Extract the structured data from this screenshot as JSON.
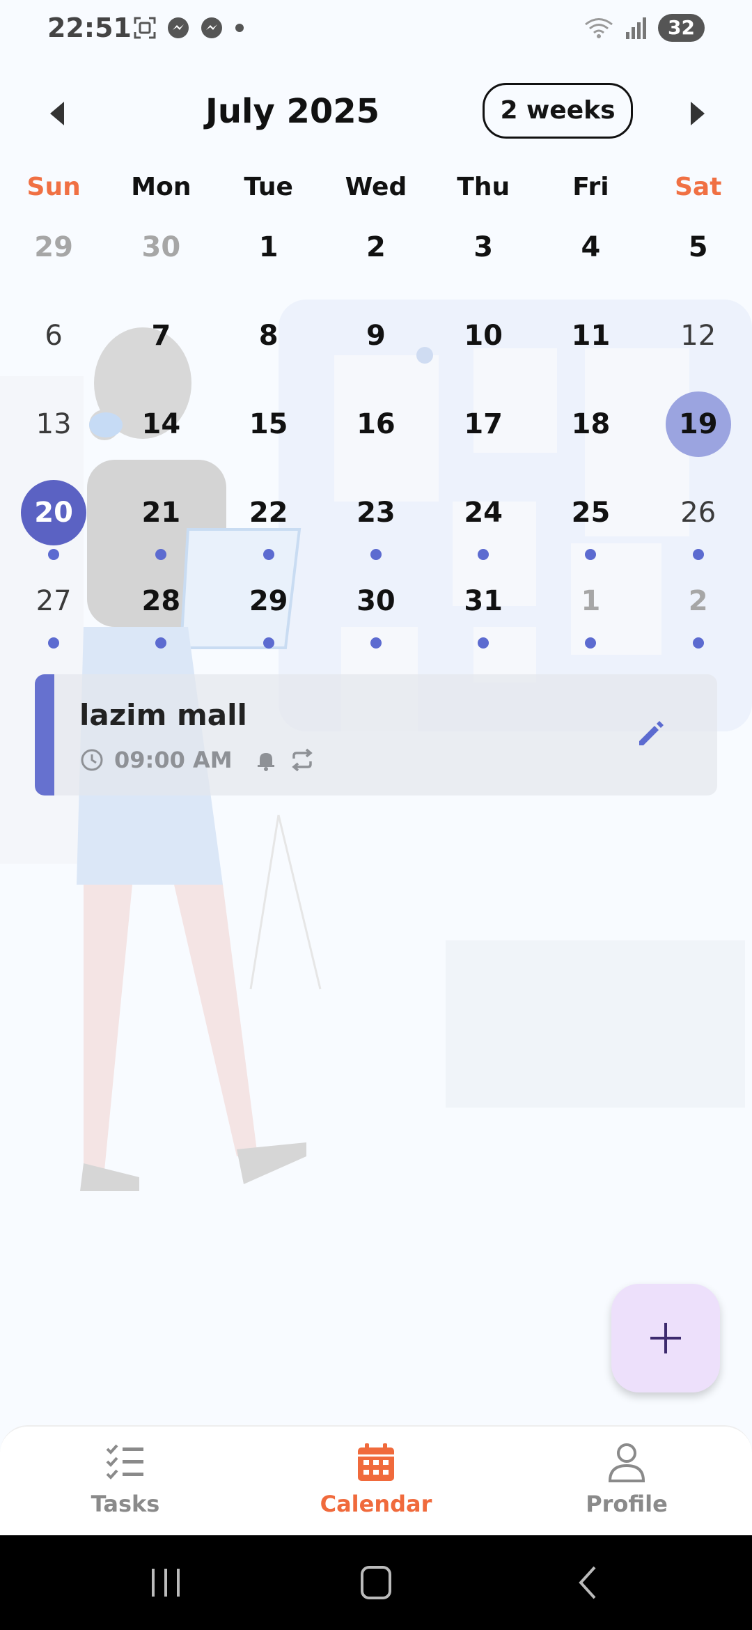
{
  "status_bar": {
    "time": "22:51",
    "battery": "32",
    "left_icons": [
      "screenshot-icon",
      "messenger-icon",
      "messenger-icon",
      "dot-icon"
    ],
    "right_icons": [
      "wifi-icon",
      "signal-icon",
      "battery-icon"
    ]
  },
  "header": {
    "month_title": "July 2025",
    "range_label": "2 weeks"
  },
  "weekdays": [
    "Sun",
    "Mon",
    "Tue",
    "Wed",
    "Thu",
    "Fri",
    "Sat"
  ],
  "calendar": {
    "weeks": [
      [
        {
          "label": "29",
          "style": "muted",
          "dot": false
        },
        {
          "label": "30",
          "style": "muted",
          "dot": false
        },
        {
          "label": "1",
          "style": "normal",
          "dot": false
        },
        {
          "label": "2",
          "style": "normal",
          "dot": false
        },
        {
          "label": "3",
          "style": "normal",
          "dot": false
        },
        {
          "label": "4",
          "style": "normal",
          "dot": false
        },
        {
          "label": "5",
          "style": "normal",
          "dot": false
        }
      ],
      [
        {
          "label": "6",
          "style": "dim",
          "dot": false
        },
        {
          "label": "7",
          "style": "normal",
          "dot": false
        },
        {
          "label": "8",
          "style": "normal",
          "dot": false
        },
        {
          "label": "9",
          "style": "normal",
          "dot": false
        },
        {
          "label": "10",
          "style": "normal",
          "dot": false
        },
        {
          "label": "11",
          "style": "normal",
          "dot": false
        },
        {
          "label": "12",
          "style": "dim",
          "dot": false
        }
      ],
      [
        {
          "label": "13",
          "style": "dim",
          "dot": false
        },
        {
          "label": "14",
          "style": "normal",
          "dot": false
        },
        {
          "label": "15",
          "style": "normal",
          "dot": false
        },
        {
          "label": "16",
          "style": "normal",
          "dot": false
        },
        {
          "label": "17",
          "style": "normal",
          "dot": false
        },
        {
          "label": "18",
          "style": "normal",
          "dot": false
        },
        {
          "label": "19",
          "style": "today",
          "dot": false
        }
      ],
      [
        {
          "label": "20",
          "style": "selected",
          "dot": true
        },
        {
          "label": "21",
          "style": "normal",
          "dot": true
        },
        {
          "label": "22",
          "style": "normal",
          "dot": true
        },
        {
          "label": "23",
          "style": "normal",
          "dot": true
        },
        {
          "label": "24",
          "style": "normal",
          "dot": true
        },
        {
          "label": "25",
          "style": "normal",
          "dot": true
        },
        {
          "label": "26",
          "style": "dim",
          "dot": true
        }
      ],
      [
        {
          "label": "27",
          "style": "dim",
          "dot": true
        },
        {
          "label": "28",
          "style": "normal",
          "dot": true
        },
        {
          "label": "29",
          "style": "normal",
          "dot": true
        },
        {
          "label": "30",
          "style": "normal",
          "dot": true
        },
        {
          "label": "31",
          "style": "normal",
          "dot": true
        },
        {
          "label": "1",
          "style": "muted",
          "dot": true
        },
        {
          "label": "2",
          "style": "muted",
          "dot": true
        }
      ]
    ]
  },
  "event": {
    "title": "lazim mall",
    "time": "09:00 AM",
    "icons": [
      "clock-icon",
      "bell-icon",
      "repeat-icon",
      "edit-icon"
    ]
  },
  "fab": {
    "icon": "plus-icon"
  },
  "bottom_nav": [
    {
      "label": "Tasks",
      "icon": "checklist-icon",
      "active": false
    },
    {
      "label": "Calendar",
      "icon": "calendar-icon",
      "active": true
    },
    {
      "label": "Profile",
      "icon": "person-icon",
      "active": false
    }
  ],
  "colors": {
    "accent": "#f06a3c",
    "weekend": "#f07043",
    "selected_day": "#5b62c3",
    "today": "#9ba4e0",
    "dot": "#5c6bd0",
    "event_bar": "#6671cf",
    "fab": "#ede0fb"
  }
}
